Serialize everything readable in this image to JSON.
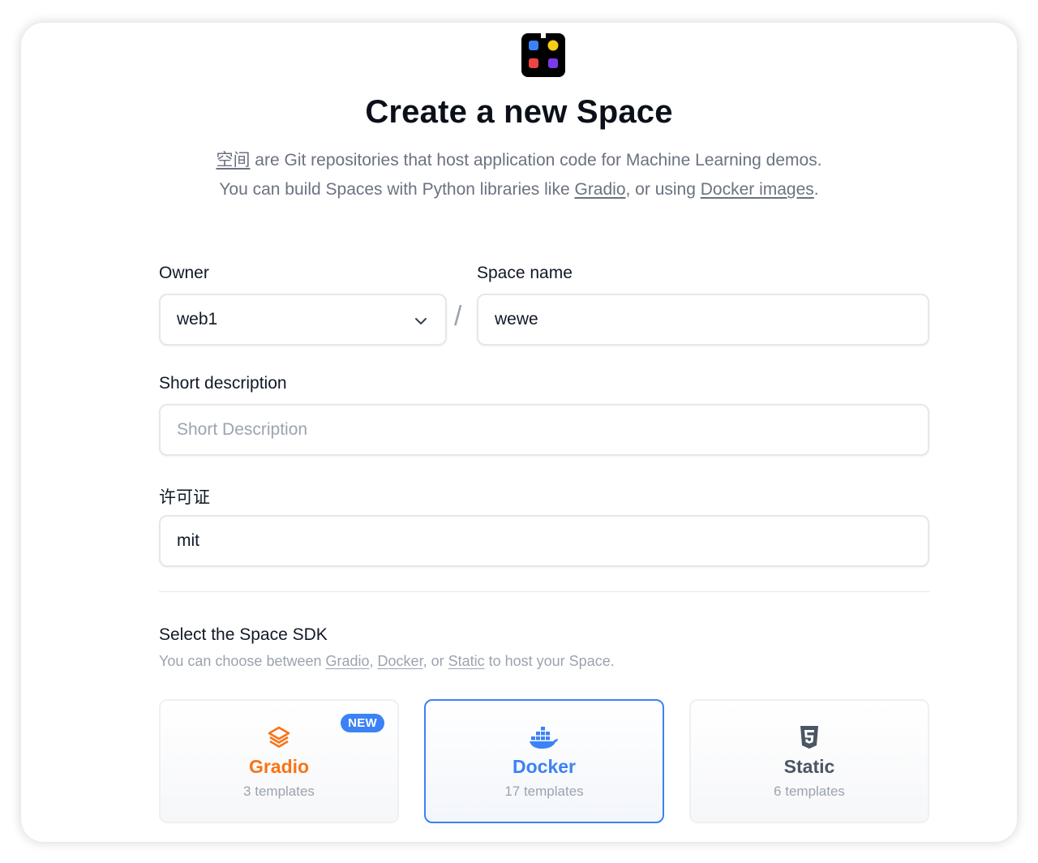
{
  "header": {
    "title": "Create a new Space",
    "intro_link_spaces": "空间",
    "intro_line1_rest": " are Git repositories that host application code for Machine Learning demos.",
    "intro_line2_a": "You can build Spaces with Python libraries like ",
    "intro_link_gradio": "Gradio",
    "intro_line2_b": ", or using ",
    "intro_link_docker": "Docker images",
    "intro_line2_c": "."
  },
  "form": {
    "owner_label": "Owner",
    "owner_value": "web1",
    "separator": "/",
    "space_name_label": "Space name",
    "space_name_value": "wewe",
    "short_desc_label": "Short description",
    "short_desc_placeholder": "Short Description",
    "license_label": "许可证",
    "license_value": "mit"
  },
  "sdk": {
    "title": "Select the Space SDK",
    "sub_a": "You can choose between ",
    "sub_gradio": "Gradio",
    "sub_sep1": ", ",
    "sub_docker": "Docker",
    "sub_sep2": ", or ",
    "sub_static": "Static",
    "sub_b": " to host your Space.",
    "options": [
      {
        "name": "Gradio",
        "count": "3 templates",
        "badge": "NEW",
        "icon": "gradio-icon",
        "color": "#f97316"
      },
      {
        "name": "Docker",
        "count": "17 templates",
        "icon": "docker-icon",
        "color": "#3b82f6",
        "selected": true
      },
      {
        "name": "Static",
        "count": "6 templates",
        "icon": "html5-icon",
        "color": "#4b5563"
      }
    ]
  },
  "colors": {
    "accent": "#3b82f6",
    "gradio": "#f97316"
  }
}
